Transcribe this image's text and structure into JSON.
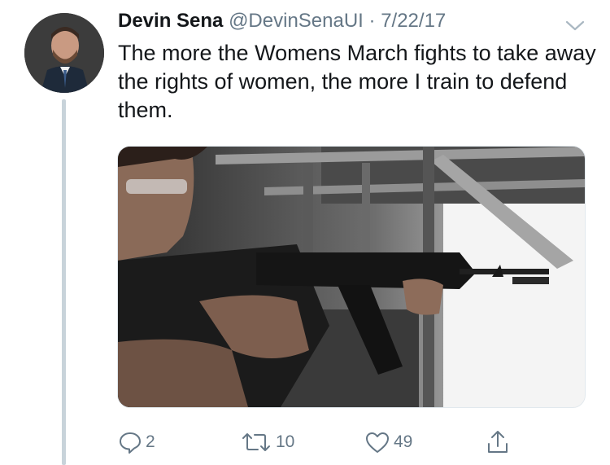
{
  "tweet": {
    "display_name": "Devin Sena",
    "handle": "@DevinSenaUI",
    "separator": "·",
    "date": "7/22/17",
    "text": "The more the Womens March fights to take away the rights of women, the more I train to defend them."
  },
  "icons": {
    "avatar": "profile-photo",
    "menu": "chevron-down-icon",
    "reply": "reply-icon",
    "retweet": "retweet-icon",
    "like": "heart-icon",
    "share": "share-icon"
  },
  "actions": {
    "replies": "2",
    "retweets": "10",
    "likes": "49"
  },
  "colors": {
    "text": "#14171a",
    "muted": "#657786",
    "thread_line": "#c8d3da"
  }
}
